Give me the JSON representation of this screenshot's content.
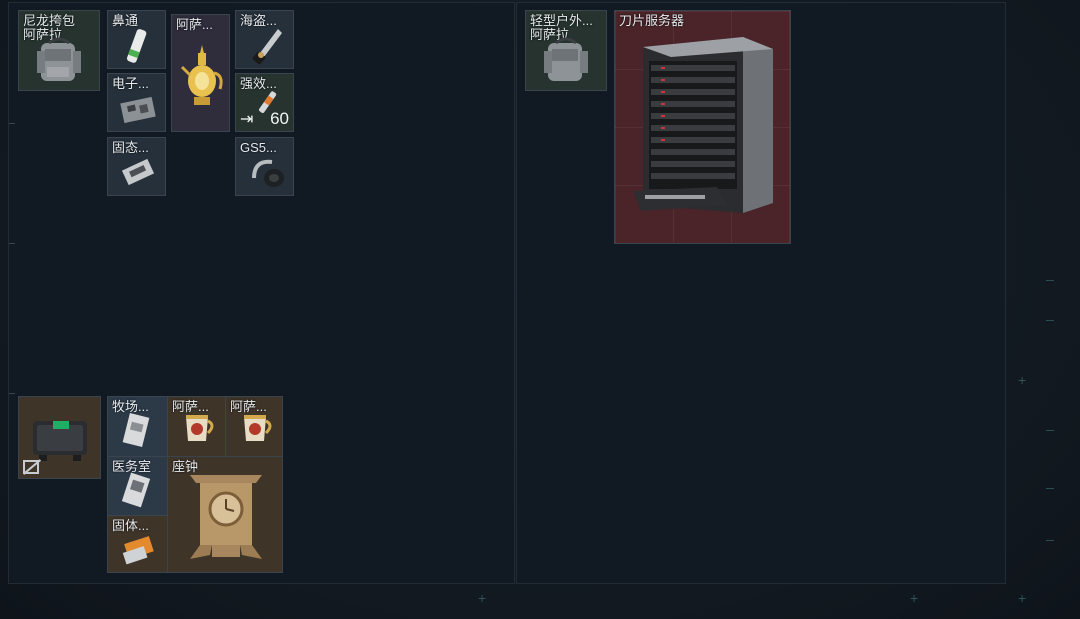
{
  "left_panel": {
    "backpack": {
      "label_line1": "尼龙挎包",
      "label_line2": "阿萨拉",
      "icon": "backpack-icon"
    },
    "items_top": [
      {
        "id": "nasal",
        "label": "鼻通",
        "icon": "nasal-spray-icon",
        "rarity": "gray"
      },
      {
        "id": "pirate-knife",
        "label": "海盗...",
        "icon": "dagger-icon",
        "rarity": "gray"
      },
      {
        "id": "asala-pot",
        "label": "阿萨...",
        "icon": "golden-ewer-icon",
        "rarity": "purple"
      },
      {
        "id": "electronic",
        "label": "电子...",
        "icon": "circuit-board-icon",
        "rarity": "gray"
      },
      {
        "id": "strong-syringe",
        "label": "强效...",
        "icon": "syringe-icon",
        "rarity": "green",
        "count": "60",
        "modifier_icon": "⇥"
      },
      {
        "id": "ssd",
        "label": "固态...",
        "icon": "ssd-icon",
        "rarity": "gray"
      },
      {
        "id": "gs5",
        "label": "GS5...",
        "icon": "headset-icon",
        "rarity": "gray"
      }
    ],
    "container": {
      "icon": "case-icon",
      "locked_icon": "no-sort-icon"
    },
    "items_bottom": [
      {
        "id": "ranch",
        "label": "牧场...",
        "icon": "document-icon",
        "rarity": "blue"
      },
      {
        "id": "asala-cup1",
        "label": "阿萨...",
        "icon": "ornate-cup-icon",
        "rarity": "gold"
      },
      {
        "id": "asala-cup2",
        "label": "阿萨...",
        "icon": "ornate-cup-icon",
        "rarity": "gold"
      },
      {
        "id": "clinic",
        "label": "医务室",
        "icon": "keycard-icon",
        "rarity": "blue"
      },
      {
        "id": "clock",
        "label": "座钟",
        "icon": "mantel-clock-icon",
        "rarity": "gold"
      },
      {
        "id": "solid-fuel",
        "label": "固体...",
        "icon": "fuel-box-icon",
        "rarity": "gold"
      }
    ]
  },
  "right_panel": {
    "backpack": {
      "label_line1": "轻型户外...",
      "label_line2": "阿萨拉",
      "icon": "backpack-icon"
    },
    "server": {
      "label": "刀片服务器",
      "icon": "blade-server-icon",
      "rarity": "red"
    }
  },
  "colors": {
    "gray": "#25303a",
    "green": "#26332e",
    "blue": "#2c3a48",
    "purple": "#2f2c3c",
    "gold": "#3e3428",
    "red": "#4a2428"
  }
}
